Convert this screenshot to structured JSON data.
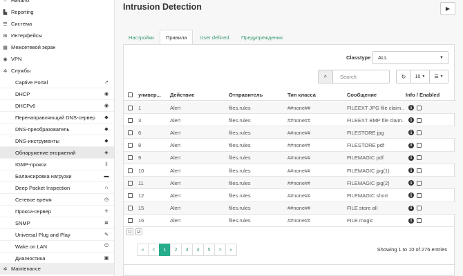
{
  "sidebar": {
    "top_items": [
      {
        "label": "Начало",
        "icon": "home-icon",
        "glyph": "⌂"
      },
      {
        "label": "Reporting",
        "icon": "chart-icon",
        "glyph": "▙"
      },
      {
        "label": "Система",
        "icon": "list-icon",
        "glyph": "☰"
      },
      {
        "label": "Интерфейсы",
        "icon": "sitemap-icon",
        "glyph": "⊞"
      },
      {
        "label": "Межсетевой экран",
        "icon": "fire-icon",
        "glyph": "▦"
      },
      {
        "label": "VPN",
        "icon": "globe-icon",
        "glyph": "◉"
      },
      {
        "label": "Службы",
        "icon": "gear-icon",
        "glyph": "✲"
      }
    ],
    "services": [
      {
        "label": "Captive Portal",
        "icon": "send-icon",
        "glyph": "➚"
      },
      {
        "label": "DHCP",
        "icon": "bullseye-icon",
        "glyph": "◉"
      },
      {
        "label": "DHCPv6",
        "icon": "bullseye-icon",
        "glyph": "◉"
      },
      {
        "label": "Перенаправляющий DNS-сервер",
        "icon": "tags-icon",
        "glyph": "◆"
      },
      {
        "label": "DNS-преобразователь",
        "icon": "tags-icon",
        "glyph": "◆"
      },
      {
        "label": "DNS-инструменты",
        "icon": "tags-icon",
        "glyph": "◆"
      },
      {
        "label": "Обнаружение вторжений",
        "icon": "shield-icon",
        "glyph": "◈"
      },
      {
        "label": "IGMP-прокси",
        "icon": "signpost-icon",
        "glyph": "‡"
      },
      {
        "label": "Балансировка нагрузки",
        "icon": "truck-icon",
        "glyph": "▬"
      },
      {
        "label": "Deep Packet Inspection",
        "icon": "headphones-icon",
        "glyph": "∩"
      },
      {
        "label": "Сетевое время",
        "icon": "clock-icon",
        "glyph": "◷"
      },
      {
        "label": "Прокси-сервер",
        "icon": "bolt-icon",
        "glyph": "ϟ"
      },
      {
        "label": "SNMP",
        "icon": "database-icon",
        "glyph": "≣"
      },
      {
        "label": "Universal Plug and Play",
        "icon": "plug-icon",
        "glyph": "✎"
      },
      {
        "label": "Wake on LAN",
        "icon": "power-icon",
        "glyph": "⏻"
      },
      {
        "label": "Диагностика",
        "icon": "medkit-icon",
        "glyph": "▣"
      }
    ],
    "maintenance": {
      "label": "Maintenance",
      "icon": "cogs-icon",
      "glyph": "✲"
    }
  },
  "header": {
    "title": "Intrusion Detection",
    "play_icon": "play-icon"
  },
  "tabs": [
    {
      "label": "Настройки",
      "active": false
    },
    {
      "label": "Правила",
      "active": true
    },
    {
      "label": "User defined",
      "active": false
    },
    {
      "label": "Предупреждения",
      "active": false
    }
  ],
  "filters": {
    "classtype_label": "Classtype",
    "classtype_value": "ALL",
    "search_placeholder": "Search",
    "page_size": "10"
  },
  "table": {
    "headers": [
      "универ...",
      "Действие",
      "Отправитель",
      "Тип класса",
      "Сообщение",
      "Info / Enabled"
    ],
    "rows": [
      {
        "sid": "1",
        "action": "Alert",
        "source": "files.rules",
        "classtype": "##none##",
        "message": "FILEEXT JPG file claim..."
      },
      {
        "sid": "3",
        "action": "Alert",
        "source": "files.rules",
        "classtype": "##none##",
        "message": "FILEEXT BMP file claim..."
      },
      {
        "sid": "6",
        "action": "Alert",
        "source": "files.rules",
        "classtype": "##none##",
        "message": "FILESTORE jpg"
      },
      {
        "sid": "8",
        "action": "Alert",
        "source": "files.rules",
        "classtype": "##none##",
        "message": "FILESTORE pdf"
      },
      {
        "sid": "9",
        "action": "Alert",
        "source": "files.rules",
        "classtype": "##none##",
        "message": "FILEMAGIC pdf"
      },
      {
        "sid": "10",
        "action": "Alert",
        "source": "files.rules",
        "classtype": "##none##",
        "message": "FILEMAGIC jpg(1)"
      },
      {
        "sid": "11",
        "action": "Alert",
        "source": "files.rules",
        "classtype": "##none##",
        "message": "FILEMAGIC jpg(2)"
      },
      {
        "sid": "12",
        "action": "Alert",
        "source": "files.rules",
        "classtype": "##none##",
        "message": "FILEMAGIC short"
      },
      {
        "sid": "15",
        "action": "Alert",
        "source": "files.rules",
        "classtype": "##none##",
        "message": "FILE store all"
      },
      {
        "sid": "16",
        "action": "Alert",
        "source": "files.rules",
        "classtype": "##none##",
        "message": "FILE magic"
      }
    ]
  },
  "pagination": {
    "pages": [
      "«",
      "<",
      "1",
      "2",
      "3",
      "4",
      "5",
      ">",
      "»"
    ],
    "current": "1",
    "showing": "Showing 1 to 10 of 276 entries"
  },
  "colors": {
    "accent": "#26ad8b",
    "link": "#3b9a72"
  }
}
